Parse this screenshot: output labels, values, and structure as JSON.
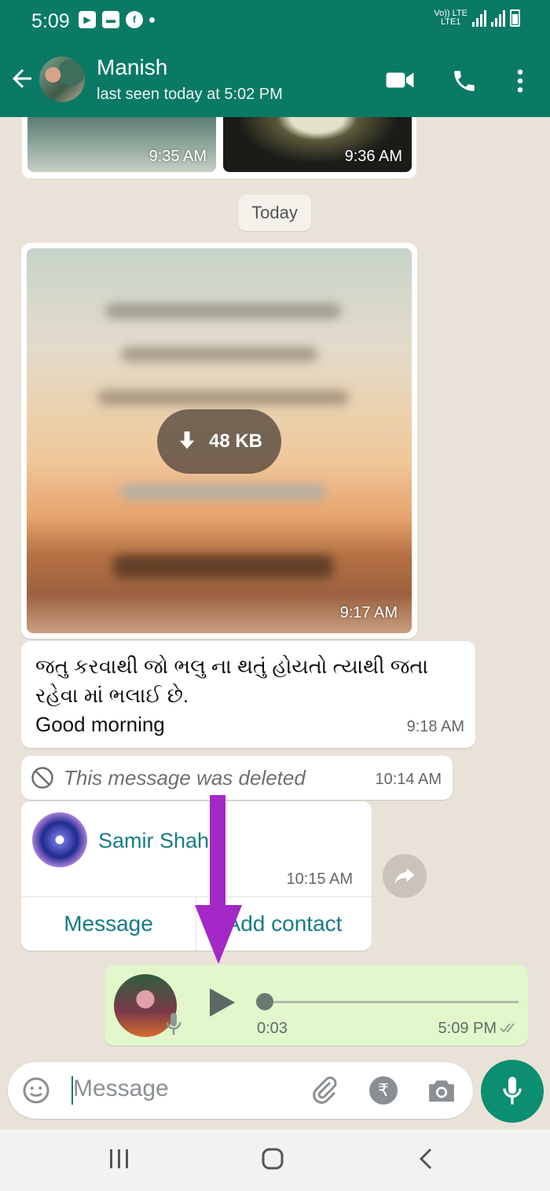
{
  "status_bar": {
    "time": "5:09",
    "network_top": "Vo)) LTE",
    "network_bottom": "LTE1"
  },
  "header": {
    "contact_name": "Manish",
    "last_seen": "last seen today at 5:02 PM"
  },
  "chat": {
    "thumbs": [
      {
        "time": "9:35 AM"
      },
      {
        "time": "9:36 AM"
      }
    ],
    "date_chip": "Today",
    "image_message": {
      "download_size": "48 KB",
      "time": "9:17 AM"
    },
    "text_message": {
      "line1": "જતુ કરવાથી જો ભલુ ના થતું હોયતો  ત્યાથી જતા",
      "line2": "રહેવા માં ભલાઈ છે.",
      "line3": "Good morning",
      "time": "9:18 AM"
    },
    "deleted_message": {
      "text": "This message was deleted",
      "time": "10:14 AM"
    },
    "contact_card": {
      "name": "Samir Shah",
      "time": "10:15 AM",
      "message_button": "Message",
      "add_contact_button": "Add contact"
    },
    "voice_message": {
      "duration": "0:03",
      "time": "5:09 PM",
      "progress": 0
    }
  },
  "input": {
    "placeholder": "Message"
  },
  "colors": {
    "header": "#0b7a65",
    "accent": "#0b8f70",
    "outgoing_bubble": "#e2f7cb",
    "annotation_arrow": "#a328c7"
  }
}
